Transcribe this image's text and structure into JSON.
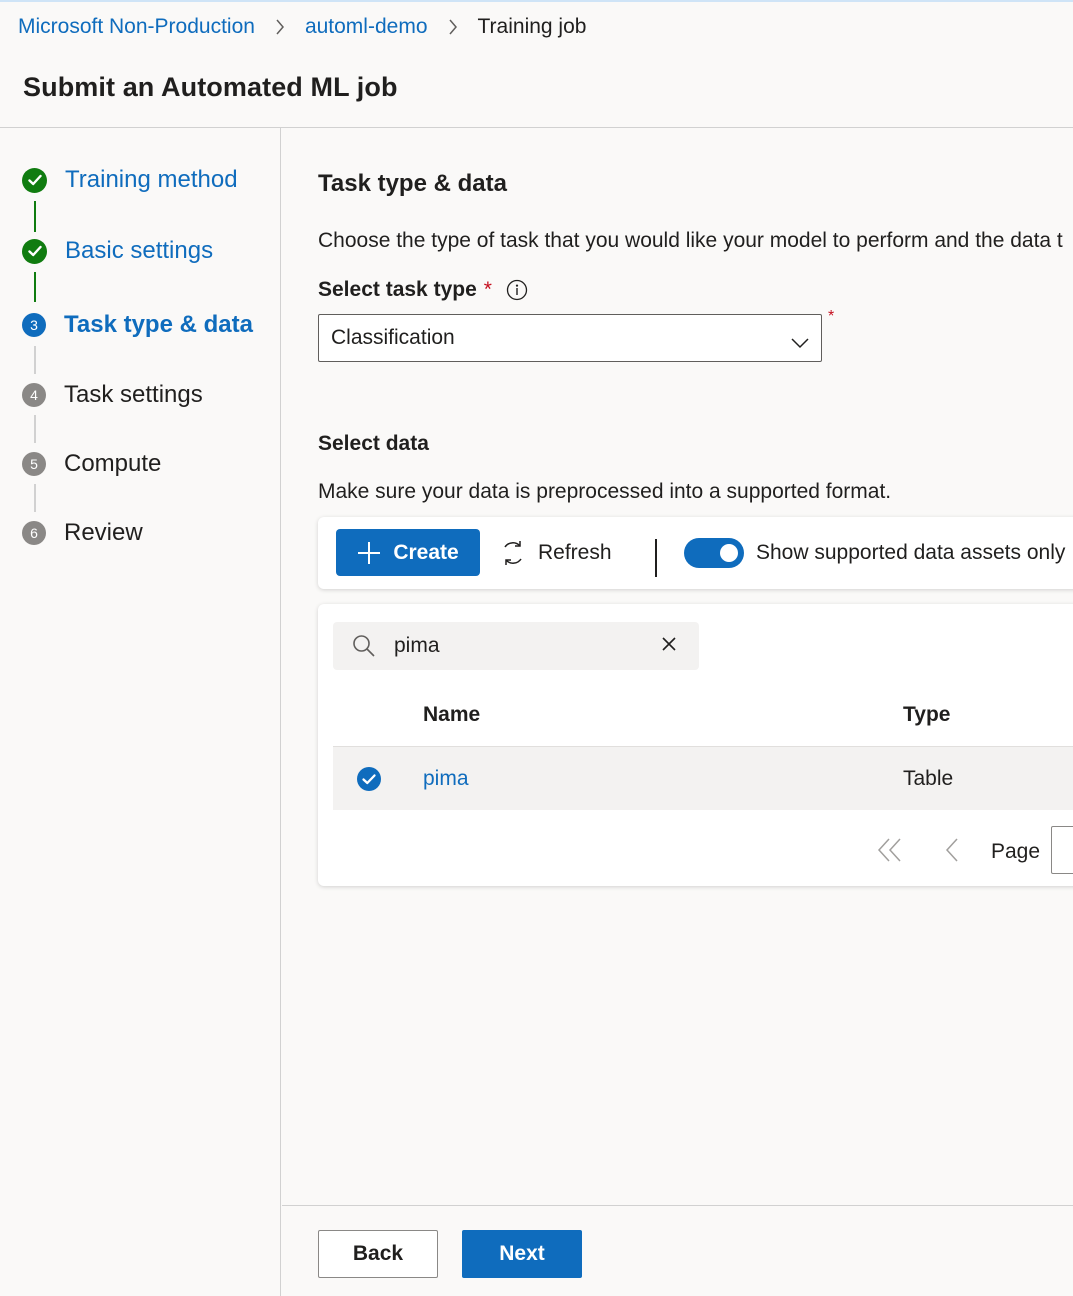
{
  "breadcrumb": {
    "items": [
      "Microsoft Non-Production",
      "automl-demo",
      "Training job"
    ]
  },
  "page_title": "Submit an Automated ML job",
  "stepper": {
    "steps": [
      {
        "label": "Training method",
        "state": "done"
      },
      {
        "label": "Basic settings",
        "state": "done"
      },
      {
        "label": "Task type & data",
        "state": "active",
        "number": "3"
      },
      {
        "label": "Task settings",
        "state": "todo",
        "number": "4"
      },
      {
        "label": "Compute",
        "state": "todo",
        "number": "5"
      },
      {
        "label": "Review",
        "state": "todo",
        "number": "6"
      }
    ]
  },
  "main": {
    "section_title": "Task type & data",
    "section_desc": "Choose the type of task that you would like your model to perform and the data t",
    "task_type": {
      "label": "Select task type",
      "required_mark": "*",
      "value": "Classification",
      "icon": "info-icon"
    },
    "select_data": {
      "title": "Select data",
      "desc": "Make sure your data is preprocessed into a supported format."
    },
    "toolbar": {
      "create_label": "Create",
      "refresh_label": "Refresh",
      "toggle_label": "Show supported data assets only",
      "toggle_on": true
    },
    "search": {
      "value": "pima",
      "icon": "search-icon"
    },
    "table": {
      "columns": [
        "Name",
        "Type"
      ],
      "rows": [
        {
          "name": "pima",
          "type": "Table",
          "selected": true
        }
      ]
    },
    "pager": {
      "label": "Page"
    }
  },
  "footer": {
    "back_label": "Back",
    "next_label": "Next"
  },
  "colors": {
    "accent": "#0f6cbd",
    "success": "#107c10",
    "required": "#c50f1f",
    "pending": "#8a8886"
  }
}
